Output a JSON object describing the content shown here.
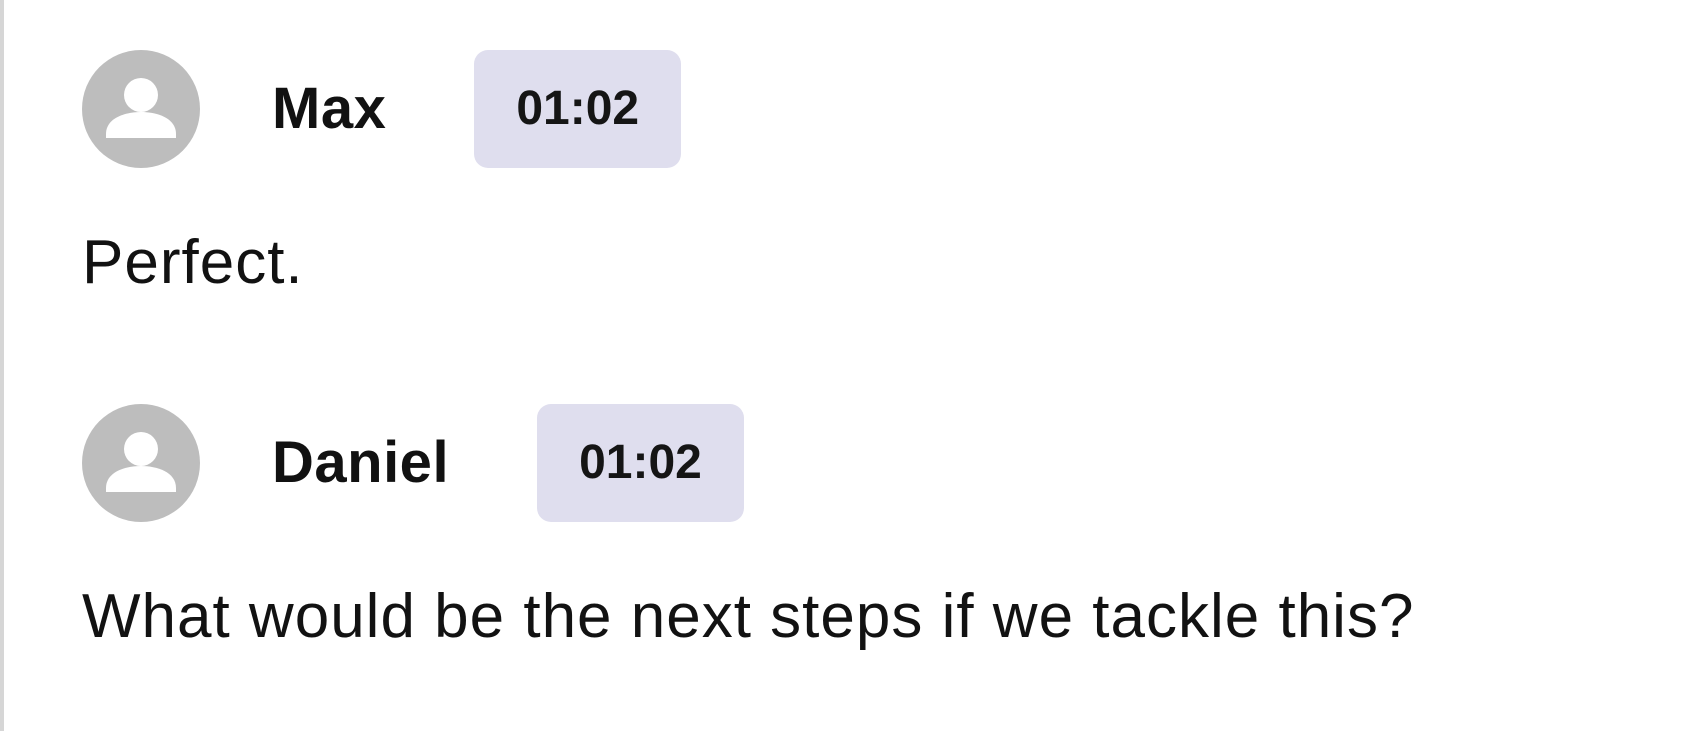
{
  "transcript": {
    "entries": [
      {
        "speaker": "Max",
        "timestamp": "01:02",
        "text": "Perfect."
      },
      {
        "speaker": "Daniel",
        "timestamp": "01:02",
        "text": "What would be the next steps if we tackle this?"
      }
    ]
  },
  "icons": {
    "avatar": "person-icon"
  },
  "colors": {
    "avatar_background": "#bdbdbd",
    "timestamp_background": "#dfdeee",
    "left_rule": "#d6d6d6"
  }
}
